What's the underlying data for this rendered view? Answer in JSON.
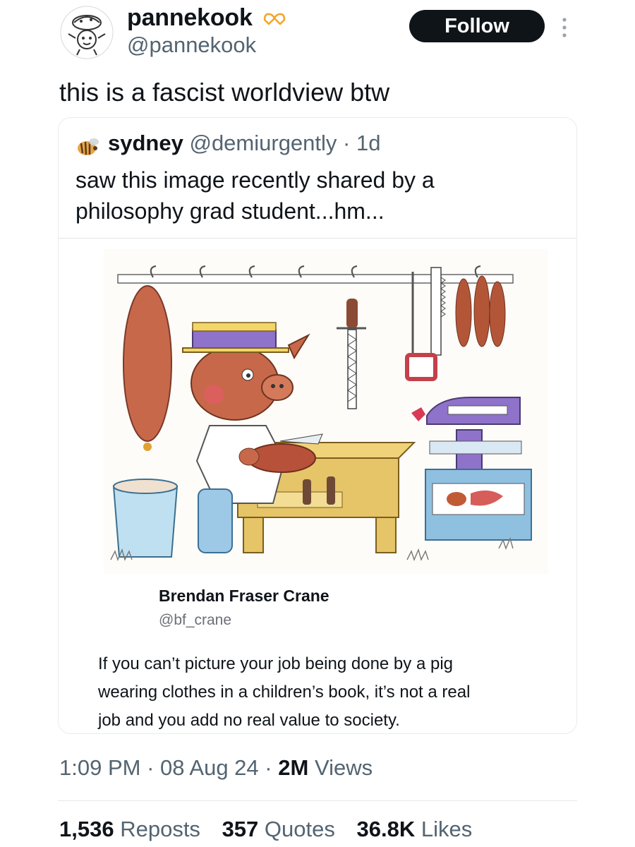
{
  "author": {
    "display_name": "pannekook",
    "handle": "@pannekook",
    "badge_icon": "heart-hands-icon",
    "avatar_icon": "doodle-avatar-icon"
  },
  "follow_label": "Follow",
  "more_icon": "vertical-ellipsis-icon",
  "tweet_text": "this is a fascist worldview btw",
  "quoted": {
    "display_name": "sydney",
    "handle": "@demiurgently",
    "separator": "·",
    "time": "1d",
    "avatar_icon": "bee-avatar-icon",
    "text": "saw this image recently shared by a\nphilosophy grad student...hm..."
  },
  "embedded_post": {
    "illustration": "pig-butcher-illustration",
    "display_name": "Brendan Fraser Crane",
    "handle": "@bf_crane",
    "text": "If you can’t picture your job being done by a pig\nwearing clothes in a children’s book, it’s not a real\njob and you add no real value to society."
  },
  "meta": {
    "time": "1:09 PM",
    "sep1": "·",
    "date": "08 Aug 24",
    "sep2": "·",
    "views_count": "2M",
    "views_label": "Views"
  },
  "stats": {
    "reposts_count": "1,536",
    "reposts_label": "Reposts",
    "quotes_count": "357",
    "quotes_label": "Quotes",
    "likes_count": "36.8K",
    "likes_label": "Likes"
  },
  "colors": {
    "text_primary": "#0f1419",
    "text_secondary": "#536471",
    "follow_bg": "#0f1419",
    "badge": "#f4a52a"
  }
}
